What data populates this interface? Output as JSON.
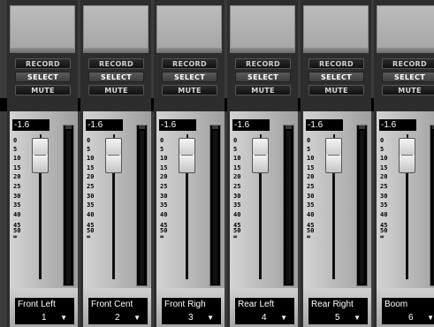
{
  "buttons": {
    "record": "RECORD",
    "select": "SELECT",
    "mute": "MUTE"
  },
  "scale_labels": [
    "0",
    "5",
    "10",
    "15",
    "20",
    "25",
    "30",
    "35",
    "40",
    "45",
    "50",
    "∞"
  ],
  "channels": [
    {
      "name": "Front Left",
      "number": "1",
      "level": "-1.6"
    },
    {
      "name": "Front Cent",
      "number": "2",
      "level": "-1.6"
    },
    {
      "name": "Front Righ",
      "number": "3",
      "level": "-1.6"
    },
    {
      "name": "Rear Left",
      "number": "4",
      "level": "-1.6"
    },
    {
      "name": "Rear Right",
      "number": "5",
      "level": "-1.6"
    },
    {
      "name": "Boom",
      "number": "6",
      "level": "-1.6"
    }
  ],
  "icons": {
    "dropdown": "▼"
  }
}
